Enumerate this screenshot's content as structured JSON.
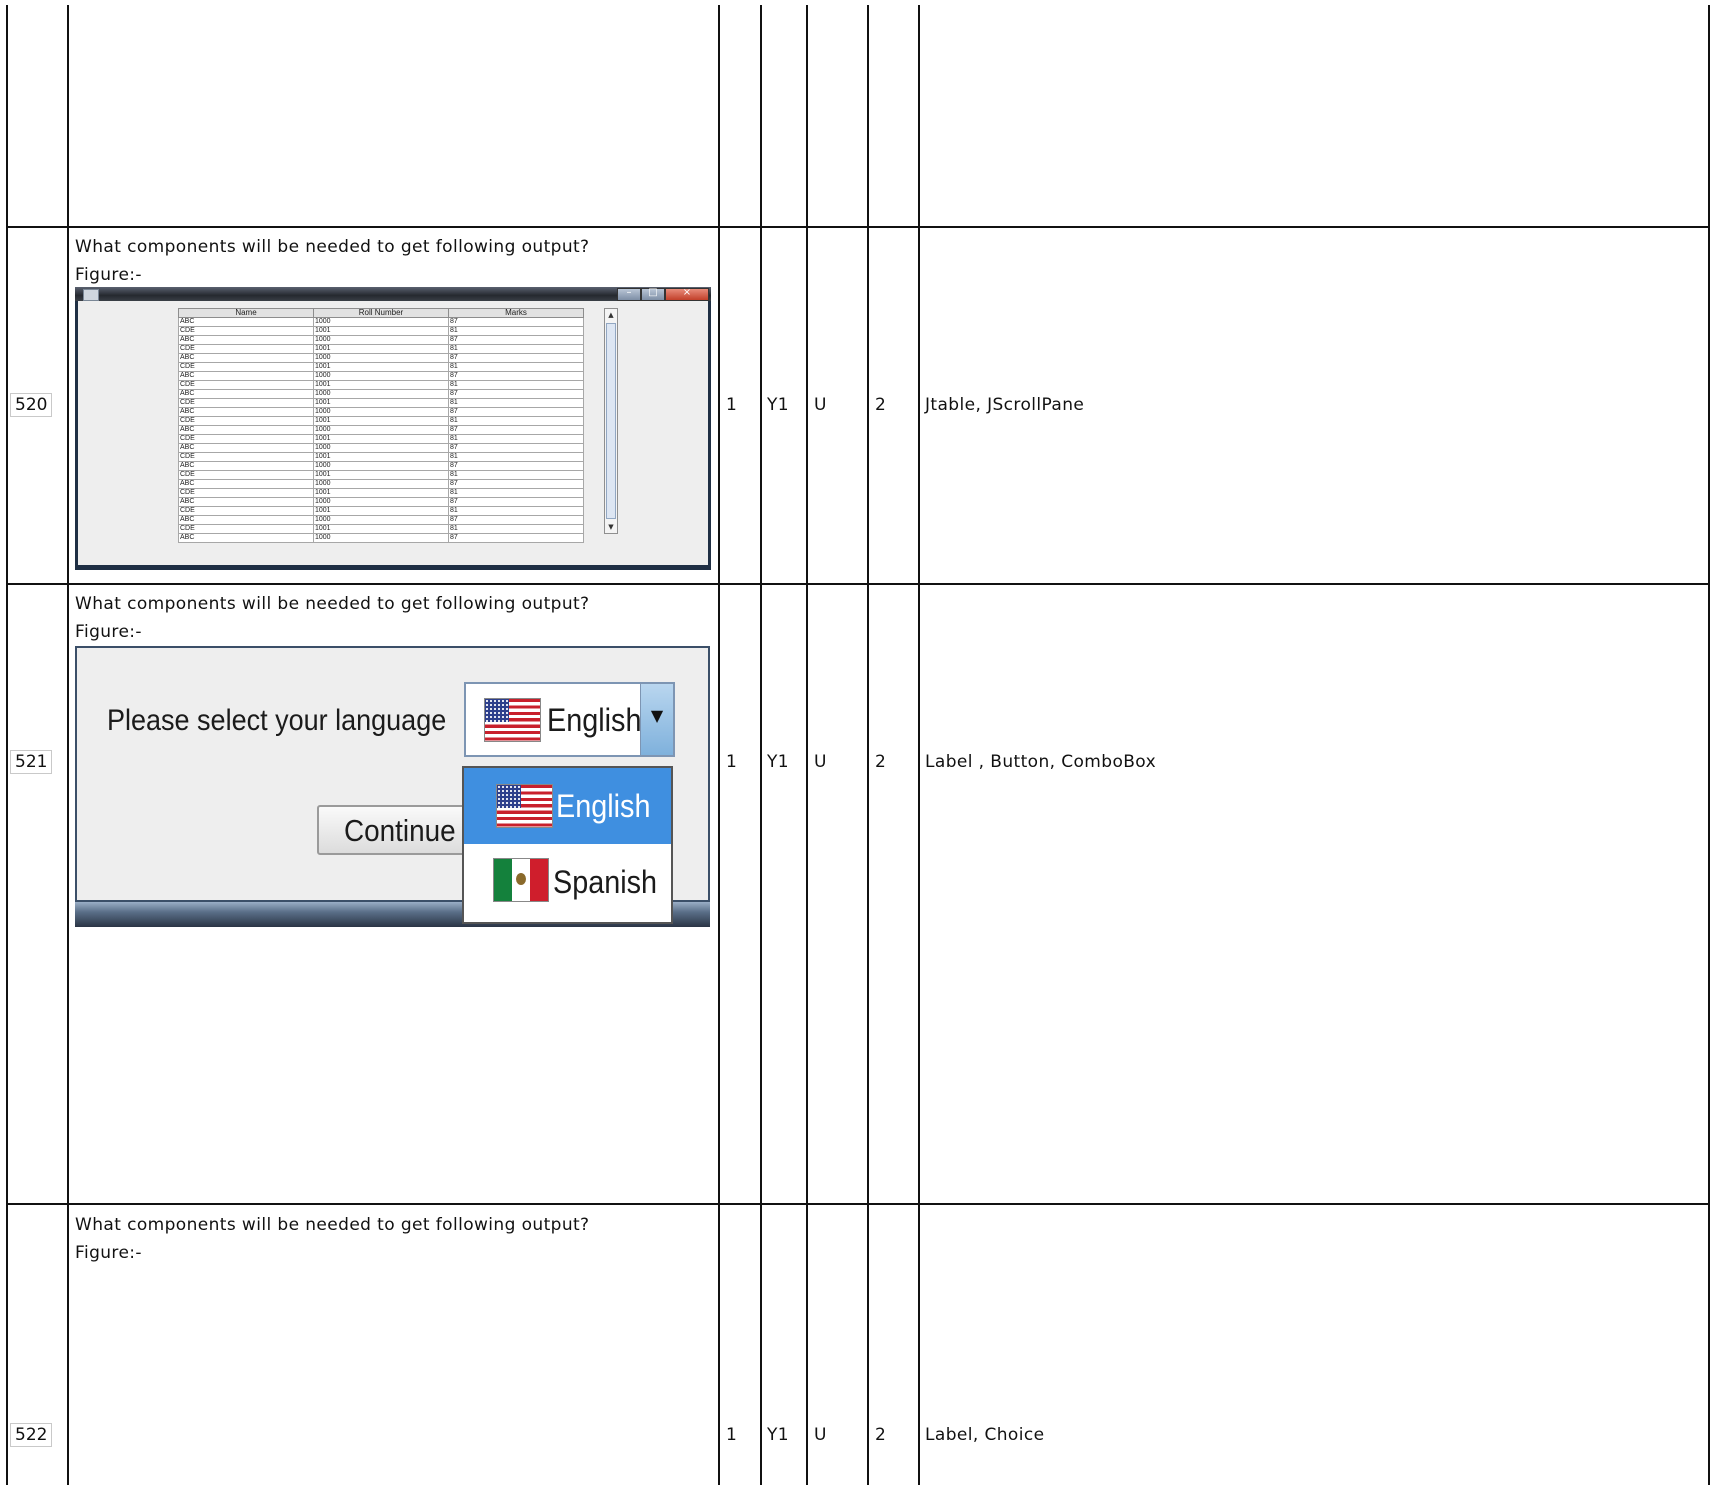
{
  "rows": [
    {
      "number": "",
      "question": "",
      "figure_label": "",
      "marks": "",
      "level": "",
      "type": "",
      "option": "",
      "answer": ""
    },
    {
      "number": "520",
      "question": "What components will be needed to get following output?",
      "figure_label": "Figure:-",
      "marks": "1",
      "level": "Y1",
      "type": "U",
      "option": "2",
      "answer": "Jtable, JScrollPane"
    },
    {
      "number": "521",
      "question": "What components will be needed to get following output?",
      "figure_label": "Figure:-",
      "marks": "1",
      "level": "Y1",
      "type": "U",
      "option": "2",
      "answer": "Label , Button, ComboBox"
    },
    {
      "number": "522",
      "question": "What components will be needed to get following output?",
      "figure_label": "Figure:-",
      "marks": "1",
      "level": "Y1",
      "type": "U",
      "option": "2",
      "answer": "Label, Choice"
    }
  ],
  "figure_table": {
    "columns": [
      "Name",
      "Roll Number",
      "Marks"
    ],
    "rows": [
      [
        "ABC",
        "1000",
        "87"
      ],
      [
        "CDE",
        "1001",
        "81"
      ],
      [
        "ABC",
        "1000",
        "87"
      ],
      [
        "CDE",
        "1001",
        "81"
      ],
      [
        "ABC",
        "1000",
        "87"
      ],
      [
        "CDE",
        "1001",
        "81"
      ],
      [
        "ABC",
        "1000",
        "87"
      ],
      [
        "CDE",
        "1001",
        "81"
      ],
      [
        "ABC",
        "1000",
        "87"
      ],
      [
        "CDE",
        "1001",
        "81"
      ],
      [
        "ABC",
        "1000",
        "87"
      ],
      [
        "CDE",
        "1001",
        "81"
      ],
      [
        "ABC",
        "1000",
        "87"
      ],
      [
        "CDE",
        "1001",
        "81"
      ],
      [
        "ABC",
        "1000",
        "87"
      ],
      [
        "CDE",
        "1001",
        "81"
      ],
      [
        "ABC",
        "1000",
        "87"
      ],
      [
        "CDE",
        "1001",
        "81"
      ],
      [
        "ABC",
        "1000",
        "87"
      ],
      [
        "CDE",
        "1001",
        "81"
      ],
      [
        "ABC",
        "1000",
        "87"
      ],
      [
        "CDE",
        "1001",
        "81"
      ],
      [
        "ABC",
        "1000",
        "87"
      ],
      [
        "CDE",
        "1001",
        "81"
      ],
      [
        "ABC",
        "1000",
        "87"
      ]
    ],
    "window_buttons": {
      "minimize": "–",
      "maximize": "□",
      "close": "×"
    }
  },
  "figure_dialog": {
    "prompt_label": "Please select your language",
    "combo_selected": "English",
    "combo_arrow": "▼",
    "options": [
      "English",
      "Spanish"
    ],
    "continue_button": "Continue"
  },
  "colors": {
    "grid": "#111111",
    "dropdown_highlight": "#3f8fe0",
    "combo_arrow_bg": "#7fb1dc"
  }
}
